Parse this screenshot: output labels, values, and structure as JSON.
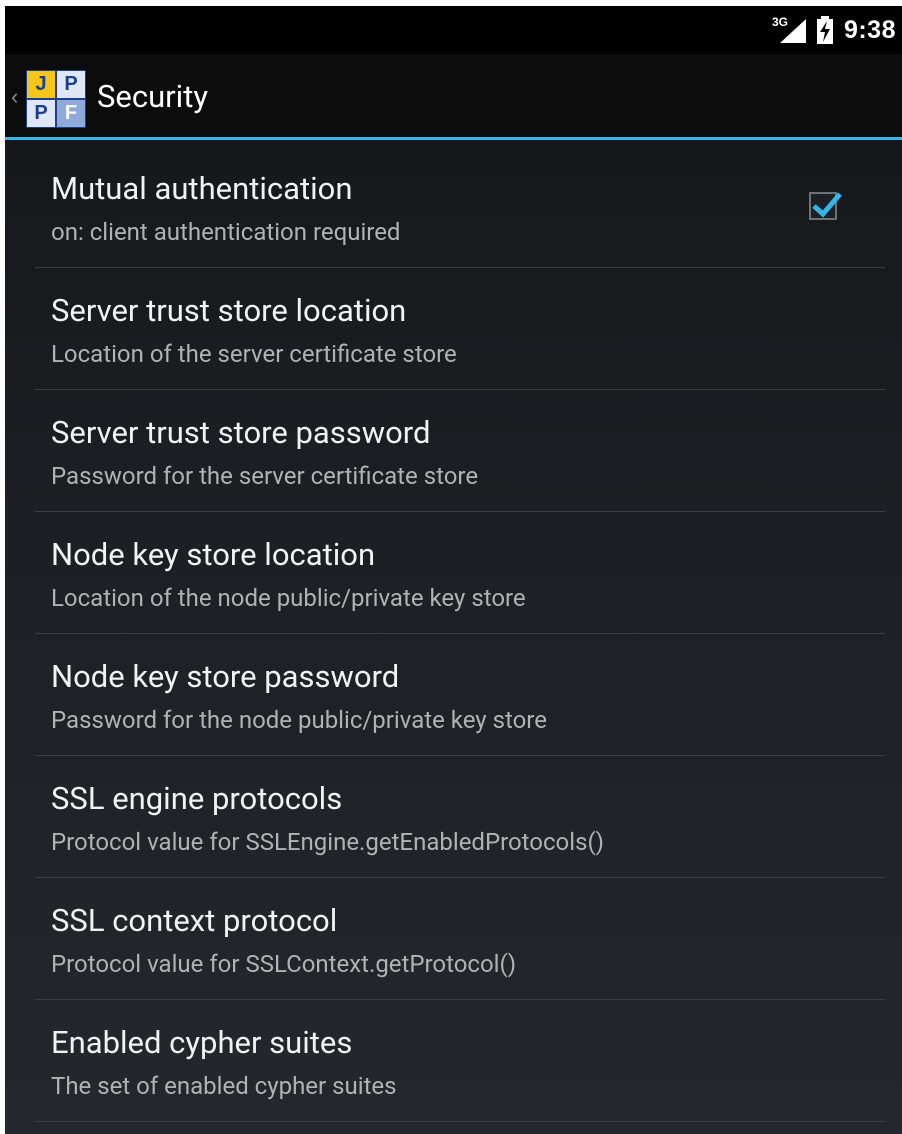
{
  "status_bar": {
    "network": "3G",
    "time": "9:38"
  },
  "action_bar": {
    "logo_letters": [
      "J",
      "P",
      "P",
      "F"
    ],
    "title": "Security"
  },
  "preferences": [
    {
      "title": "Mutual authentication",
      "summary": "on: client authentication required",
      "checked": true
    },
    {
      "title": "Server trust store location",
      "summary": "Location of the server certificate store"
    },
    {
      "title": "Server trust store password",
      "summary": "Password for the server certificate store"
    },
    {
      "title": "Node key store location",
      "summary": "Location of the node public/private key store"
    },
    {
      "title": "Node key store password",
      "summary": "Password for the node public/private key store"
    },
    {
      "title": "SSL engine protocols",
      "summary": "Protocol value for SSLEngine.getEnabledProtocols()"
    },
    {
      "title": "SSL context protocol",
      "summary": "Protocol value for SSLContext.getProtocol()"
    },
    {
      "title": "Enabled cypher suites",
      "summary": "The set of enabled cypher suites"
    }
  ],
  "colors": {
    "accent": "#33b5e5",
    "background_top": "#141618",
    "background_bottom": "#24282d"
  }
}
